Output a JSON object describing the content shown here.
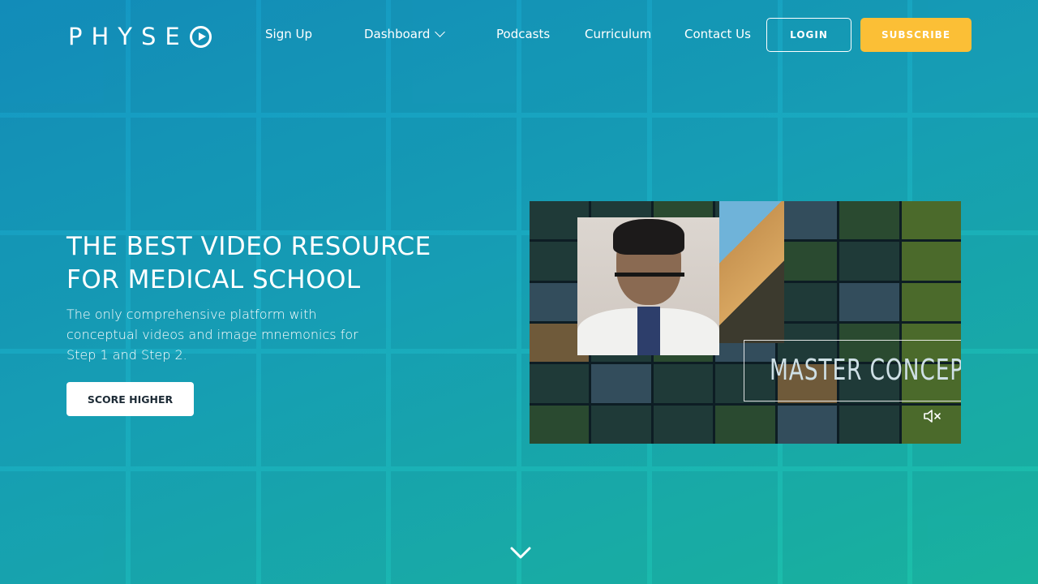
{
  "header": {
    "logo_text": "PHYSE",
    "nav": [
      {
        "label": "Sign Up"
      },
      {
        "label": "Dashboard"
      },
      {
        "label": "Podcasts"
      },
      {
        "label": "Curriculum"
      },
      {
        "label": "Contact Us"
      }
    ],
    "login_label": "LOGIN",
    "subscribe_label": "SUBSCRIBE"
  },
  "hero": {
    "title_line1": "THE BEST VIDEO RESOURCE",
    "title_line2": "FOR MEDICAL SCHOOL",
    "subtitle": "The only comprehensive platform with conceptual videos and image mnemonics for Step 1 and Step 2.",
    "cta_label": "SCORE HIGHER"
  },
  "video": {
    "overlay_text": "MASTER CONCEPT",
    "mute_icon": "speaker-muted-icon"
  },
  "colors": {
    "accent_yellow": "#fbbf36",
    "bg_start": "#1496c4",
    "bg_end": "#1cc0a6"
  },
  "icons": {
    "dashboard_dropdown": "chevron-down-icon",
    "scroll_down": "chevron-down-icon",
    "logo_play": "play-circle-icon"
  }
}
